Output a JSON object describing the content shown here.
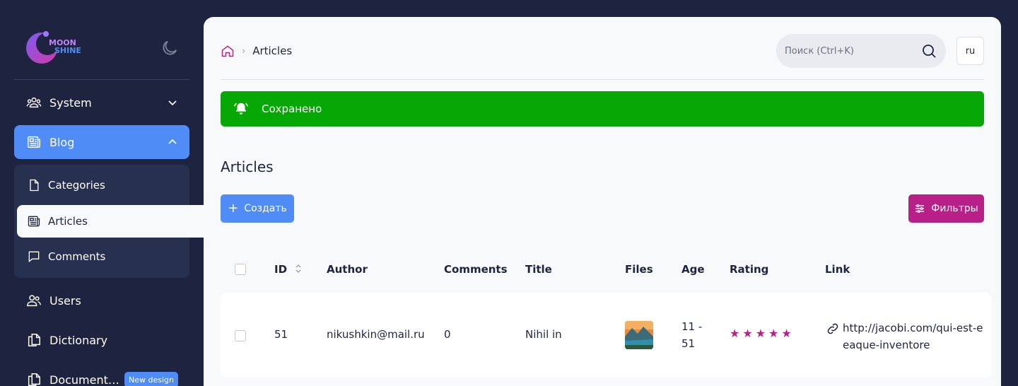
{
  "sidebar": {
    "logo_text": "MOON SHINE",
    "items": [
      {
        "label": "System",
        "icon": "users-group-icon"
      },
      {
        "label": "Blog",
        "icon": "newspaper-icon"
      },
      {
        "label": "Users",
        "icon": "users-icon"
      },
      {
        "label": "Dictionary",
        "icon": "documents-icon"
      },
      {
        "label": "Document…",
        "icon": "documents-icon",
        "badge": "New design"
      }
    ],
    "blog_submenu": [
      {
        "label": "Categories",
        "icon": "document-icon"
      },
      {
        "label": "Articles",
        "icon": "newspaper-icon"
      },
      {
        "label": "Comments",
        "icon": "chat-icon"
      }
    ]
  },
  "header": {
    "breadcrumb": {
      "current": "Articles"
    },
    "search": {
      "placeholder": "Поиск (Ctrl+K)"
    },
    "language": "ru"
  },
  "toast": {
    "message": "Сохранено",
    "color": "#05a805"
  },
  "page": {
    "title": "Articles",
    "create_label": "Создать",
    "filters_label": "Фильтры"
  },
  "table": {
    "columns": [
      "ID",
      "Author",
      "Comments",
      "Title",
      "Files",
      "Age",
      "Rating",
      "Link"
    ],
    "rows": [
      {
        "id": "51",
        "author": "nikushkin@mail.ru",
        "comments": "0",
        "title": "Nihil in",
        "age_line1": "11 -",
        "age_line2": "51",
        "rating": 5,
        "link_line1": "http://jacobi.com/qui-est-e",
        "link_line2": "eaque-inventore"
      }
    ]
  },
  "colors": {
    "sidebar_bg": "#1e2440",
    "accent_blue": "#4f8cf5",
    "accent_magenta": "#b81f87",
    "success_green": "#05a805"
  }
}
